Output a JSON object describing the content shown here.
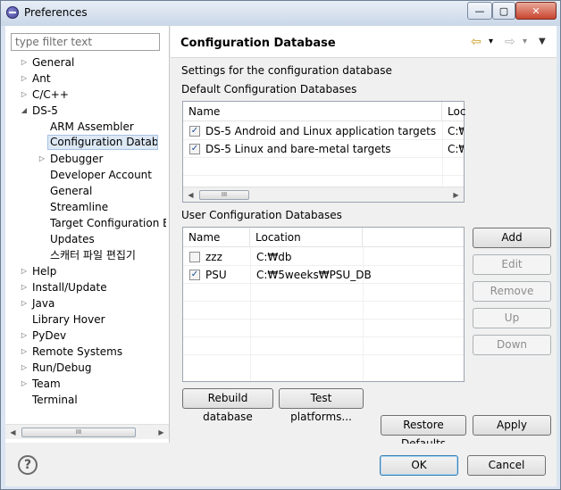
{
  "window": {
    "title": "Preferences",
    "minimize": "—",
    "maximize": "▢",
    "close": "✕",
    "icon": "eclipse-icon"
  },
  "filter": {
    "placeholder": "type filter text",
    "value": ""
  },
  "tree": {
    "items": [
      {
        "label": "General",
        "twisty": "▷"
      },
      {
        "label": "Ant",
        "twisty": "▷"
      },
      {
        "label": "C/C++",
        "twisty": "▷"
      },
      {
        "label": "DS-5",
        "twisty": "◢"
      },
      {
        "label": "ARM Assembler"
      },
      {
        "label": "Configuration Database"
      },
      {
        "label": "Debugger",
        "twisty": "▷"
      },
      {
        "label": "Developer Account"
      },
      {
        "label": "General"
      },
      {
        "label": "Streamline"
      },
      {
        "label": "Target Configuration Ed"
      },
      {
        "label": "Updates"
      },
      {
        "label": "스캐터 파일 편집기"
      },
      {
        "label": "Help",
        "twisty": "▷"
      },
      {
        "label": "Install/Update",
        "twisty": "▷"
      },
      {
        "label": "Java",
        "twisty": "▷"
      },
      {
        "label": "Library Hover"
      },
      {
        "label": "PyDev",
        "twisty": "▷"
      },
      {
        "label": "Remote Systems",
        "twisty": "▷"
      },
      {
        "label": "Run/Debug",
        "twisty": "▷"
      },
      {
        "label": "Team",
        "twisty": "▷"
      },
      {
        "label": "Terminal"
      }
    ],
    "scroll_left": "◀",
    "scroll_right": "▶",
    "scroll_thumb": "III"
  },
  "page": {
    "title": "Configuration Database",
    "nav_back": "⇦",
    "nav_forward": "⇨",
    "nav_dropdown": "▾",
    "view_menu": "▼",
    "description": "Settings for the configuration database",
    "default_label": "Default Configuration Databases",
    "user_label": "User Configuration Databases"
  },
  "default_table": {
    "columns": [
      "Name",
      "Loc"
    ],
    "rows": [
      {
        "checked": "✓",
        "name": "DS-5 Android and Linux application targets",
        "location": "C:₩"
      },
      {
        "checked": "✓",
        "name": "DS-5 Linux and bare-metal targets",
        "location": "C:₩"
      }
    ],
    "scroll_left": "◀",
    "scroll_right": "▶",
    "scroll_thumb": "III"
  },
  "user_table": {
    "columns": [
      "Name",
      "Location"
    ],
    "rows": [
      {
        "checked": "",
        "name": "zzz",
        "location": "C:₩db"
      },
      {
        "checked": "✓",
        "name": "PSU",
        "location": "C:₩5weeks₩PSU_DB"
      }
    ]
  },
  "buttons": {
    "add": "Add",
    "edit": "Edit",
    "remove": "Remove",
    "up": "Up",
    "down": "Down",
    "rebuild": "Rebuild database",
    "test_platforms": "Test platforms...",
    "restore_defaults": "Restore Defaults",
    "apply": "Apply",
    "ok": "OK",
    "cancel": "Cancel",
    "help": "?"
  }
}
